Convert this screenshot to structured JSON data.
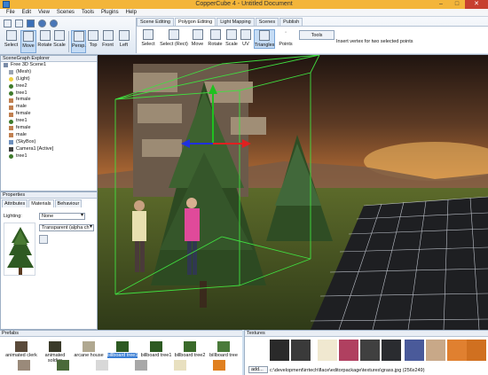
{
  "window": {
    "title": "CopperCube 4 - Untitled Document"
  },
  "menu": [
    "File",
    "Edit",
    "View",
    "Scenes",
    "Tools",
    "Plugins",
    "Help"
  ],
  "toolbar": {
    "left_tools": [
      "Select",
      "Move",
      "Rotate",
      "Scale"
    ],
    "view_tools": [
      "Persp.",
      "Top",
      "Front",
      "Left"
    ],
    "active_tool": "Move",
    "active_view": "Persp."
  },
  "panel_tabs": [
    "Scene Editing",
    "Polygon Editing",
    "Light Mapping",
    "Scenes",
    "Publish"
  ],
  "active_panel_tab": "Polygon Editing",
  "polygon_tools": [
    "Select",
    "Select (Rect)",
    "Move",
    "Rotate",
    "Scale",
    "UV",
    "Triangles",
    "Points"
  ],
  "active_polygon_tool": "Triangles",
  "tools_button": "Tools",
  "hint_text": "Insert vertex for two selected points",
  "scenegraph": {
    "title": "SceneGraph Explorer",
    "items": [
      {
        "label": "Free 3D Scene1",
        "kind": "root"
      },
      {
        "label": "(Mesh)",
        "kind": "mesh"
      },
      {
        "label": "(Light)",
        "kind": "light"
      },
      {
        "label": "tree2",
        "kind": "tree"
      },
      {
        "label": "tree1",
        "kind": "tree"
      },
      {
        "label": "female",
        "kind": "person"
      },
      {
        "label": "male",
        "kind": "person"
      },
      {
        "label": "female",
        "kind": "person"
      },
      {
        "label": "tree1",
        "kind": "tree"
      },
      {
        "label": "female",
        "kind": "person"
      },
      {
        "label": "male",
        "kind": "person"
      },
      {
        "label": "(SkyBox)",
        "kind": "sky"
      },
      {
        "label": "Camera1 [Active]",
        "kind": "cam"
      },
      {
        "label": "tree1",
        "kind": "tree"
      }
    ]
  },
  "properties": {
    "title": "Properties",
    "tabs": [
      "Attributes",
      "Materials",
      "Behaviour"
    ],
    "active_tab": "Materials",
    "lighting_label": "Lighting:",
    "lighting_value": "None",
    "material_type": "Transparent (alpha ch"
  },
  "prefabs": {
    "title": "Prefabs",
    "items": [
      "animated clerk",
      "animated soldier",
      "arcane house",
      "billboard tree1",
      "billboard tree1",
      "billboard tree2",
      "billboard tree"
    ],
    "selected": "billboard tree1"
  },
  "textures": {
    "title": "Textures",
    "add_label": "add...",
    "path": "c:\\development\\irrtech\\flace\\editorpackage\\textures\\grass.jpg (256x249)"
  },
  "colors": {
    "titlebar": "#f3b53a",
    "selection": "#3c7fd4",
    "grid": "#d8dde6",
    "gizmo_x": "#e02020",
    "gizmo_y": "#20c020",
    "gizmo_z": "#2030e0"
  }
}
